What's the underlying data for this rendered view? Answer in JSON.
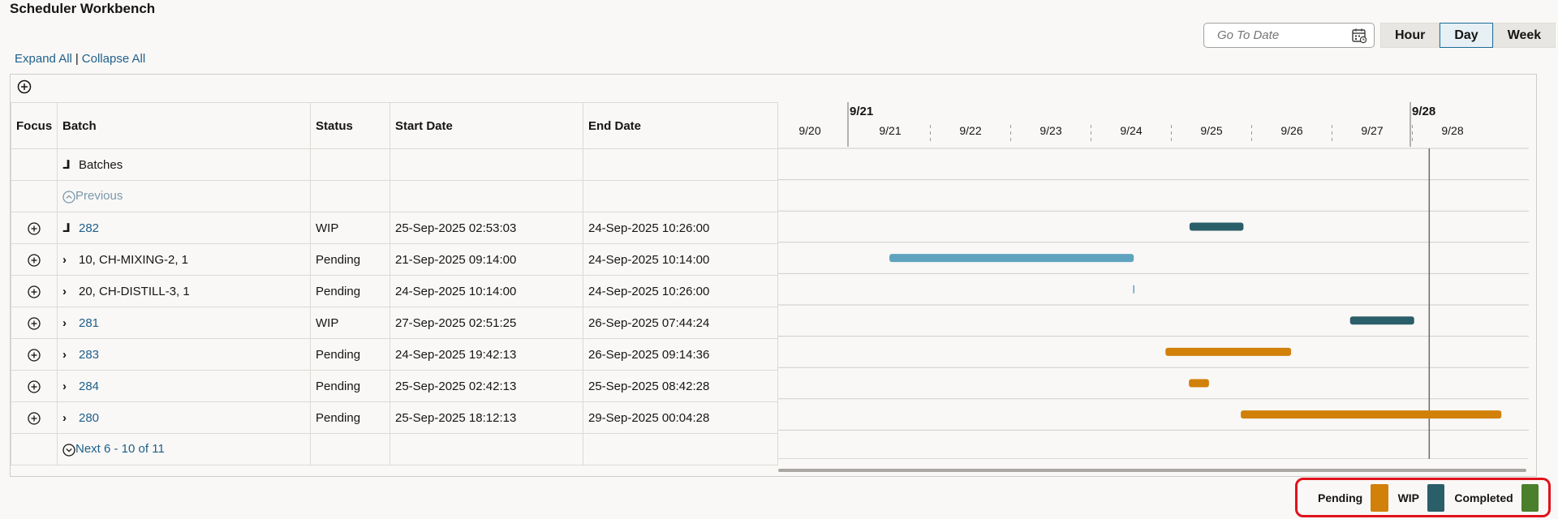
{
  "app": {
    "title": "Scheduler Workbench"
  },
  "toolbar": {
    "expand_all": "Expand All",
    "separator": "|",
    "collapse_all": "Collapse All",
    "goto_placeholder": "Go To Date",
    "scale_buttons": [
      "Hour",
      "Day",
      "Week"
    ],
    "selected_scale": "Day"
  },
  "columns": {
    "focus": "Focus",
    "batch": "Batch",
    "status": "Status",
    "start": "Start Date",
    "end": "End Date"
  },
  "rows": [
    {
      "batch": "Batches",
      "status": "",
      "start": "",
      "end": ""
    },
    {
      "batch": "Previous",
      "status": "",
      "start": "",
      "end": ""
    },
    {
      "batch": "282",
      "status": "WIP",
      "start": "25-Sep-2025 02:53:03",
      "end": "24-Sep-2025 10:26:00"
    },
    {
      "batch": "10, CH-MIXING-2, 1",
      "status": "Pending",
      "start": "21-Sep-2025 09:14:00",
      "end": "24-Sep-2025 10:14:00"
    },
    {
      "batch": "20, CH-DISTILL-3, 1",
      "status": "Pending",
      "start": "24-Sep-2025 10:14:00",
      "end": "24-Sep-2025 10:26:00"
    },
    {
      "batch": "281",
      "status": "WIP",
      "start": "27-Sep-2025 02:51:25",
      "end": "26-Sep-2025 07:44:24"
    },
    {
      "batch": "283",
      "status": "Pending",
      "start": "24-Sep-2025 19:42:13",
      "end": "26-Sep-2025 09:14:36"
    },
    {
      "batch": "284",
      "status": "Pending",
      "start": "25-Sep-2025 02:42:13",
      "end": "25-Sep-2025 08:42:28"
    },
    {
      "batch": "280",
      "status": "Pending",
      "start": "25-Sep-2025 18:12:13",
      "end": "29-Sep-2025 00:04:28"
    },
    {
      "batch": "Next 6 - 10 of 11",
      "status": "",
      "start": "",
      "end": ""
    }
  ],
  "timeline": {
    "major": [
      "9/21",
      "9/28"
    ],
    "minor": [
      "9/20",
      "9/21",
      "9/22",
      "9/23",
      "9/24",
      "9/25",
      "9/26",
      "9/27",
      "9/28"
    ],
    "origin_date": "2025-09-20",
    "current_date": "2025-09-28 02:30",
    "bars": [
      {
        "row": 2,
        "start": "2025-09-25 02:53",
        "end": "2025-09-25 19:00",
        "status": "WIP"
      },
      {
        "row": 3,
        "start": "2025-09-21 09:14",
        "end": "2025-09-24 10:14",
        "status": "Pending-light"
      },
      {
        "row": 4,
        "start": "2025-09-24 10:14",
        "end": "2025-09-24 10:26",
        "status": "Pending-tick"
      },
      {
        "row": 5,
        "start": "2025-09-27 02:51",
        "end": "2025-09-27 22:00",
        "status": "WIP"
      },
      {
        "row": 6,
        "start": "2025-09-24 19:42",
        "end": "2025-09-26 09:14",
        "status": "Pending"
      },
      {
        "row": 7,
        "start": "2025-09-25 02:42",
        "end": "2025-09-25 08:42",
        "status": "Pending"
      },
      {
        "row": 8,
        "start": "2025-09-25 18:12",
        "end": "2025-09-29 00:04",
        "status": "Pending"
      }
    ]
  },
  "legend": [
    {
      "label": "Pending",
      "color": "#d1800a"
    },
    {
      "label": "WIP",
      "color": "#2a5e68"
    },
    {
      "label": "Completed",
      "color": "#4a7f2c"
    }
  ],
  "colors": {
    "wip": "#2a5e68",
    "pending": "#d1800a",
    "pending_light": "#5fa3bf",
    "link": "#1f5f8b",
    "current_line": "#6f6c68"
  }
}
